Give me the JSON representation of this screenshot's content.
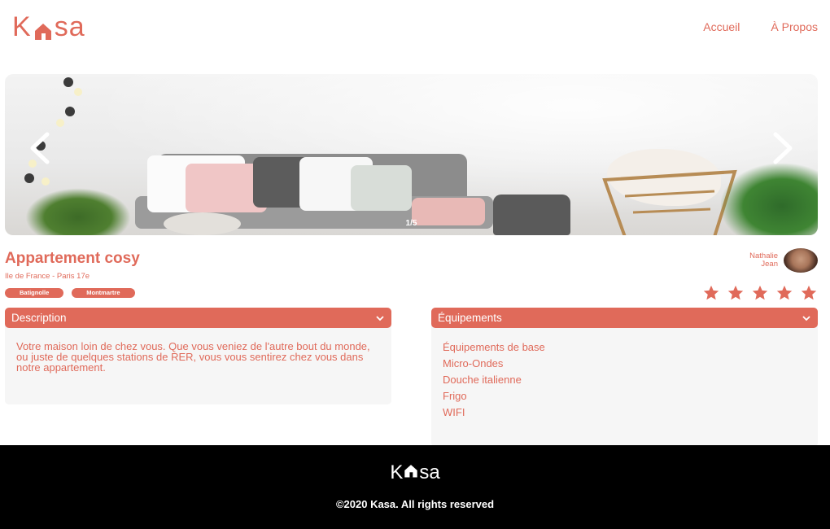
{
  "header": {
    "logo_left": "K",
    "logo_right": "sa",
    "nav": [
      "Accueil",
      "À Propos"
    ]
  },
  "gallery": {
    "counter": "1/5",
    "prev_icon": "chevron-left-icon",
    "next_icon": "chevron-right-icon"
  },
  "listing": {
    "title": "Appartement cosy",
    "location": "Ile de France - Paris 17e",
    "tags": [
      "Batignolle",
      "Montmartre"
    ],
    "host": {
      "first_name": "Nathalie",
      "last_name": "Jean"
    },
    "rating": 5,
    "rating_max": 5
  },
  "description": {
    "label": "Description",
    "text": "Votre maison loin de chez vous. Que vous veniez de l'autre bout du monde, ou juste de quelques stations de RER, vous vous sentirez chez vous dans notre appartement."
  },
  "equipments": {
    "label": "Équipements",
    "items": [
      "Équipements de base",
      "Micro-Ondes",
      "Douche italienne",
      "Frigo",
      "WIFI"
    ]
  },
  "footer": {
    "logo_left": "K",
    "logo_right": "sa",
    "copyright": "©2020 Kasa. All rights reserved"
  },
  "colors": {
    "accent": "#e06a5a",
    "footer_bg": "#000000",
    "panel_bg": "#f6f6f6"
  }
}
